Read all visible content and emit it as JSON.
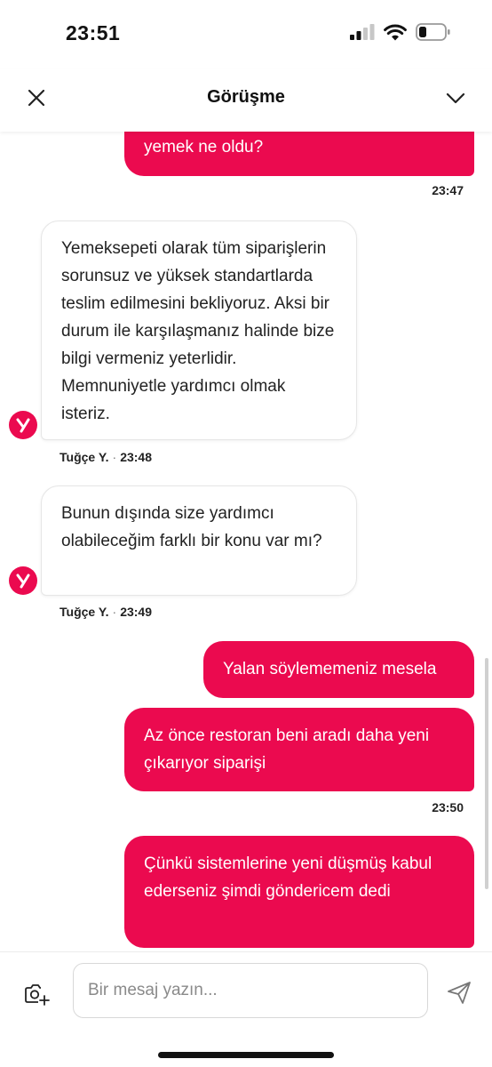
{
  "status_bar": {
    "time": "23:51"
  },
  "header": {
    "title": "Görüşme"
  },
  "messages": [
    {
      "direction": "outgoing",
      "text": "yemek ne oldu?",
      "time": "23:47"
    },
    {
      "direction": "incoming",
      "text": "Yemeksepeti olarak tüm siparişlerin sorunsuz ve yüksek standartlarda teslim edilmesini bekliyoruz. Aksi bir durum ile karşılaşmanız halinde bize bilgi vermeniz yeterlidir. Memnuniyetle yardımcı olmak isteriz.",
      "agent": "Tuğçe Y.",
      "separator": "·",
      "time": "23:48"
    },
    {
      "direction": "incoming",
      "text": "Bunun dışında size yardımcı olabileceğim farklı bir konu var mı?",
      "agent": "Tuğçe Y.",
      "separator": "·",
      "time": "23:49"
    },
    {
      "direction": "outgoing",
      "text": "Yalan söylememeniz mesela"
    },
    {
      "direction": "outgoing",
      "text": "Az önce restoran beni aradı daha yeni çıkarıyor siparişi",
      "time": "23:50"
    },
    {
      "direction": "outgoing",
      "text": "Çünkü sistemlerine yeni düşmüş kabul ederseniz şimdi göndericem dedi"
    }
  ],
  "composer": {
    "placeholder": "Bir mesaj yazın..."
  },
  "colors": {
    "accent": "#eb0a4f",
    "bubble_in_border": "#e6e6e6"
  },
  "icons": {
    "close": "close-icon",
    "chevron": "chevron-down-icon",
    "avatar": "yemeksepeti-logo-icon",
    "camera": "camera-add-icon",
    "send": "send-icon"
  }
}
